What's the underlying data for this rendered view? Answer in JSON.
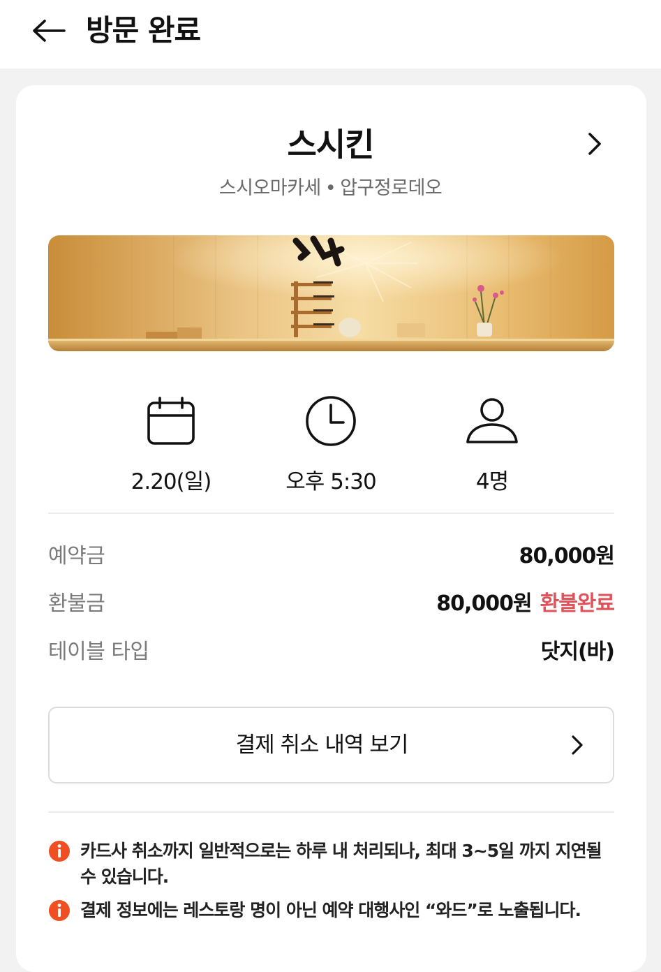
{
  "header": {
    "title": "방문 완료",
    "back_icon": "arrow-left-icon"
  },
  "restaurant": {
    "name": "스시킨",
    "category": "스시오마카세",
    "location": "압구정로데오",
    "separator": "•",
    "chevron_icon": "chevron-right-icon",
    "photo_description_icon": "restaurant-photo"
  },
  "summary": {
    "date": "2.20(일)",
    "time": "오후 5:30",
    "party_size": "4명",
    "date_icon": "calendar-icon",
    "time_icon": "clock-icon",
    "party_icon": "person-icon"
  },
  "details": {
    "deposit_label": "예약금",
    "deposit_value": "80,000원",
    "refund_label": "환불금",
    "refund_value": "80,000원",
    "refund_status": "환불완료",
    "table_label": "테이블 타입",
    "table_value": "닷지(바)"
  },
  "history_button": {
    "label": "결제 취소 내역 보기",
    "icon": "chevron-right-icon"
  },
  "notices": [
    {
      "text": "카드사 취소까지 일반적으로는 하루 내 처리되나, 최대 3~5일 까지 지연될 수 있습니다.",
      "icon": "info-icon"
    },
    {
      "text": "결제 정보에는 레스토랑 명이 아닌 예약 대행사인 “와드”로 노출됩니다.",
      "icon": "info-icon"
    }
  ],
  "colors": {
    "accent_red": "#e0525a",
    "notice_orange": "#f04e23",
    "background": "#f2f2f2"
  }
}
